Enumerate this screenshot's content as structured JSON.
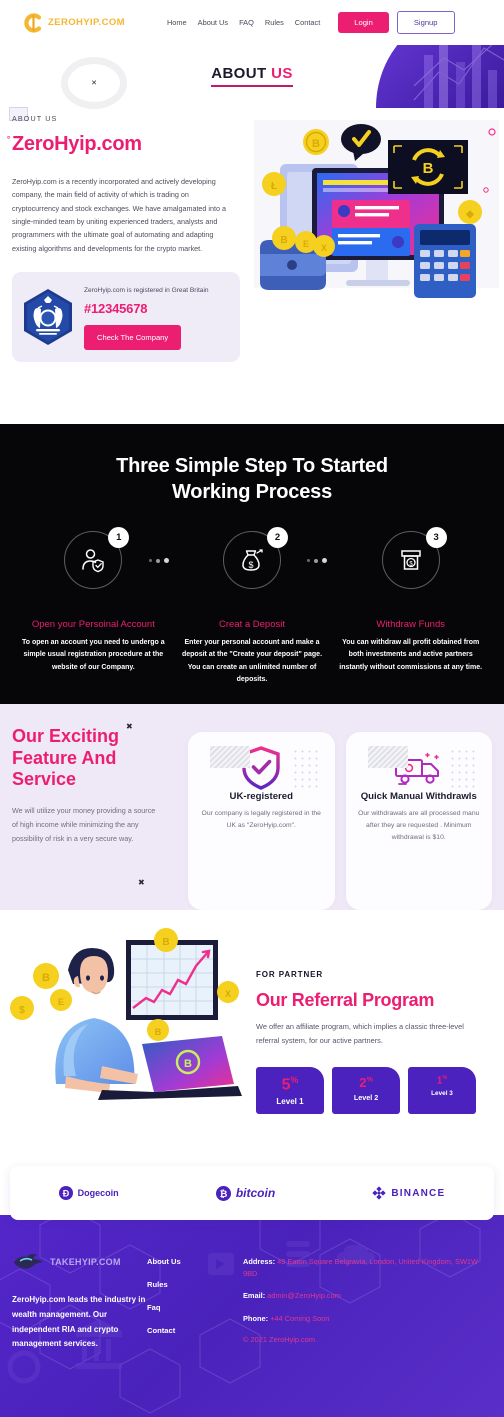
{
  "header": {
    "logo_text": "ZEROHYIP.COM",
    "logo_icon": "c-crypto-logo-icon",
    "nav": [
      {
        "label": "Home"
      },
      {
        "label": "About Us"
      },
      {
        "label": "FAQ"
      },
      {
        "label": "Rules"
      },
      {
        "label": "Contact"
      }
    ],
    "login_label": "Login",
    "signup_label": "Signup"
  },
  "hero": {
    "title_bold": "ABOUT",
    "title_accent": "US",
    "spinner_glyph": "✕"
  },
  "about": {
    "eyebrow": "ABOUT US",
    "heading": "ZeroHyip.com",
    "paragraph": "ZeroHyip.com is a recently incorporated and actively developing company, the main field of activity of which is trading on cryptocurrency and stock exchanges. We have amalgamated into a single-minded team by uniting experienced traders, analysts and programmers with the ultimate goal of automating and adapting existing algorithms and developments for the crypto market.",
    "registration": {
      "crest_icon": "royal-coat-of-arms-icon",
      "text": "ZeroHyip.com is registered in Great Britain",
      "number": "#12345678",
      "button_label": "Check The Company"
    },
    "illustration_icon": "crypto-trading-illustration"
  },
  "steps": {
    "heading_line1": "Three Simple Step To Started",
    "heading_line2": "Working Process",
    "items": [
      {
        "number": "1",
        "icon": "user-shield-icon",
        "title": "Open your Persoinal Account",
        "text": "To open an account you need to undergo a simple usual registration procedure at the website of our Company."
      },
      {
        "number": "2",
        "icon": "money-bag-icon",
        "title": "Creat a Deposit",
        "text": "Enter your personal account and make a deposit at the \"Create your deposit\" page. You can create an unlimited number of deposits."
      },
      {
        "number": "3",
        "icon": "atm-withdraw-icon",
        "title": "Withdraw Funds",
        "text": "You can withdraw all profit obtained from both investments and active partners instantly without commissions at any time."
      }
    ]
  },
  "features": {
    "heading": "Our Exciting Feature And Service",
    "paragraph": "We will utilize your money providing a source of high income while minimizing the any possibility of risk in a very secure way.",
    "cards": [
      {
        "icon": "shield-check-icon",
        "title": "UK-registered",
        "text": "Our company is legally registered in the UK as \"ZeroHyip.com\"."
      },
      {
        "icon": "money-truck-icon",
        "title": "Quick Manual Withdrawls",
        "text": "Our withdrawals are all processed manu after they are requested . Minimum withdrawal is $10."
      }
    ]
  },
  "referral": {
    "illustration_icon": "man-laptop-chart-illustration",
    "eyebrow": "FOR PARTNER",
    "heading": "Our Referral Program",
    "paragraph": "We offer an affiliate program, which implies a classic three-level referral system, for our active partners.",
    "levels": [
      {
        "percent": "5",
        "symbol": "%",
        "label": "Level 1"
      },
      {
        "percent": "2",
        "symbol": "%",
        "label": "Level 2"
      },
      {
        "percent": "1",
        "symbol": "%",
        "label": "Level 3"
      }
    ]
  },
  "payments": [
    {
      "icon": "dogecoin-icon",
      "name": "Dogecoin"
    },
    {
      "icon": "bitcoin-icon",
      "name": "bitcoin"
    },
    {
      "icon": "binance-icon",
      "name": "BINANCE"
    }
  ],
  "footer": {
    "logo_icon": "bird-logo-icon",
    "logo_text": "TAKEHYIP.COM",
    "description": "ZeroHyip.com leads the industry in wealth management. Our independent RIA and crypto management services.",
    "links": [
      {
        "label": "About Us"
      },
      {
        "label": "Rules"
      },
      {
        "label": "Faq"
      },
      {
        "label": "Contact"
      }
    ],
    "address_label": "Address:",
    "address_value": "49 Eaton Square Belgravia, London, United Kingdom, SW1W 9BD",
    "email_label": "Email:",
    "email_value": "admin@ZeroHyip.com",
    "phone_label": "Phone:",
    "phone_value": "+44 Coming Soon",
    "copyright": "© 2021 ZeroHyip.com"
  },
  "colors": {
    "accent_pink": "#EC1E72",
    "purple": "#4B22BE",
    "logo_gold": "#F5B731",
    "dark": "#060608"
  }
}
